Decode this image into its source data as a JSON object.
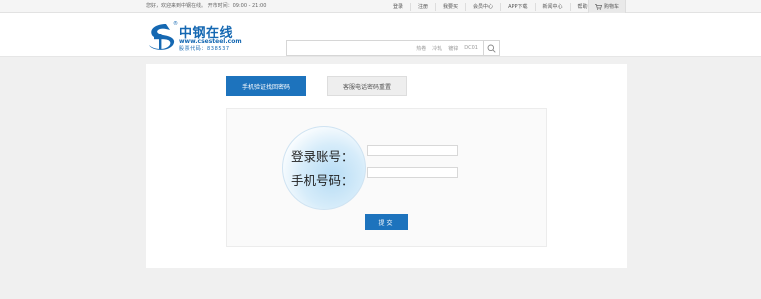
{
  "topbar": {
    "welcome": "您好，欢迎来到中钢在线。 开市时间：09:00 - 21:00",
    "links": [
      "登录",
      "注册",
      "我要买",
      "会员中心",
      "APP下载",
      "新闻中心",
      "帮助中心"
    ],
    "cart_label": "购物车",
    "cart_icon": "cart-icon"
  },
  "logo": {
    "name": "中钢在线",
    "reg": "®",
    "url": "www.csesteel.com",
    "stock": "股票代码：838537"
  },
  "search": {
    "value": "",
    "hints": [
      "热卷",
      "冷轧",
      "镀锌",
      "DC01"
    ],
    "icon": "search-icon"
  },
  "tabs": {
    "active": "手机验证找回密码",
    "inactive": "客服电话密码重置"
  },
  "form": {
    "account_label": "登录账号：",
    "phone_label": "手机号码：",
    "account_value": "",
    "phone_value": "",
    "submit_label": "提交"
  },
  "colors": {
    "primary": "#1d73bd",
    "brand": "#1568b2",
    "page_bg": "#f0f0f0"
  }
}
